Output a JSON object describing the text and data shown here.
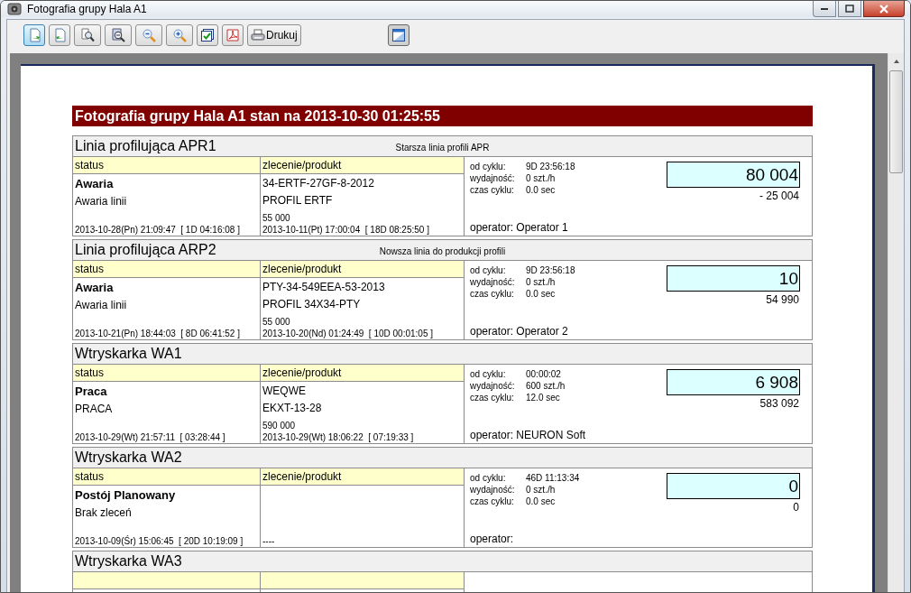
{
  "window": {
    "title": "Fotografia grupy Hala A1"
  },
  "toolbar": {
    "buttons": [
      {
        "selected": true
      },
      {
        "selected": false
      },
      {
        "selected": false
      },
      {
        "selected": false
      },
      {
        "selected": false
      },
      {
        "selected": false
      },
      {
        "selected": false
      },
      {
        "selected": false
      },
      {
        "label": "Drukuj",
        "selected": false
      }
    ],
    "view_button": {
      "selected": true
    }
  },
  "report": {
    "title": "Fotografia grupy Hala A1 stan na 2013-10-30 01:25:55",
    "sections": [
      {
        "name": "Linia profilująca APR1",
        "description": "Starsza linia profili APR",
        "status_header": "status",
        "order_header": "zlecenie/produkt",
        "status": {
          "state": "Awaria",
          "reason": "Awaria linii",
          "since": "2013-10-28(Pn) 21:09:47  [ 1D 04:16:08 ]"
        },
        "order": {
          "code": "34-ERTF-27GF-8-2012",
          "product": "PROFIL ERTF",
          "quantity": "55 000",
          "since": "2013-10-11(Pt) 17:00:04  [ 18D 08:25:50 ]"
        },
        "info": [
          {
            "label": "od cyklu:",
            "value": "9D 23:56:18"
          },
          {
            "label": "wydajność:",
            "value": "0 szt./h"
          },
          {
            "label": "czas cyklu:",
            "value": "0.0 sec"
          }
        ],
        "operator_label": "operator:",
        "operator": "Operator 1",
        "counter": "80 004",
        "counter_diff": "- 25 004"
      },
      {
        "name": "Linia profilująca ARP2",
        "description": "Nowsza linia do produkcji profili",
        "status_header": "status",
        "order_header": "zlecenie/produkt",
        "status": {
          "state": "Awaria",
          "reason": "Awaria linii",
          "since": "2013-10-21(Pn) 18:44:03  [ 8D 06:41:52 ]"
        },
        "order": {
          "code": "PTY-34-549EEA-53-2013",
          "product": "PROFIL 34X34-PTY",
          "quantity": "55 000",
          "since": "2013-10-20(Nd) 01:24:49  [ 10D 00:01:05 ]"
        },
        "info": [
          {
            "label": "od cyklu:",
            "value": "9D 23:56:18"
          },
          {
            "label": "wydajność:",
            "value": "0 szt./h"
          },
          {
            "label": "czas cyklu:",
            "value": "0.0 sec"
          }
        ],
        "operator_label": "operator:",
        "operator": "Operator 2",
        "counter": "10",
        "counter_diff": "54 990"
      },
      {
        "name": "Wtryskarka WA1",
        "status_header": "status",
        "order_header": "zlecenie/produkt",
        "status": {
          "state": "Praca",
          "reason": "PRACA",
          "since": "2013-10-29(Wt) 21:57:11  [ 03:28:44 ]"
        },
        "order": {
          "code": "WEQWE",
          "product": "EKXT-13-28",
          "quantity": "590 000",
          "since": "2013-10-29(Wt) 18:06:22  [ 07:19:33 ]"
        },
        "info": [
          {
            "label": "od cyklu:",
            "value": "00:00:02"
          },
          {
            "label": "wydajność:",
            "value": "600 szt./h"
          },
          {
            "label": "czas cyklu:",
            "value": "12.0 sec"
          }
        ],
        "operator_label": "operator:",
        "operator": "NEURON Soft",
        "counter": "6 908",
        "counter_diff": "583 092"
      },
      {
        "name": "Wtryskarka WA2",
        "status_header": "status",
        "order_header": "zlecenie/produkt",
        "status": {
          "state": "Postój Planowany",
          "reason": "Brak zleceń",
          "since": "2013-10-09(Śr) 15:06:45  [ 20D 10:19:09 ]"
        },
        "order": {
          "since": "----"
        },
        "info": [
          {
            "label": "od cyklu:",
            "value": "46D 11:13:34"
          },
          {
            "label": "wydajność:",
            "value": "0 szt./h"
          },
          {
            "label": "czas cyklu:",
            "value": "0.0 sec"
          }
        ],
        "operator_label": "operator:",
        "counter": "0",
        "counter_diff": "0"
      },
      {
        "name": "Wtryskarka WA3"
      }
    ]
  }
}
